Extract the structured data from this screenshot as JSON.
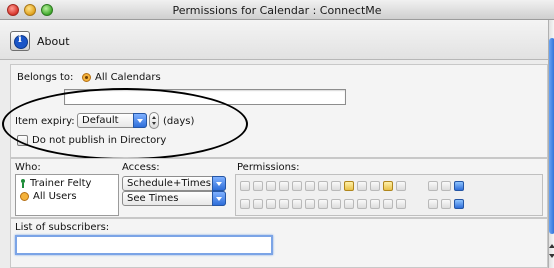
{
  "window": {
    "title": "Permissions for Calendar : ConnectMe"
  },
  "toolbar": {
    "about_label": "About"
  },
  "belongs": {
    "label": "Belongs to:",
    "value": "All Calendars",
    "extra_value": ""
  },
  "expiry": {
    "label": "Item expiry:",
    "select_value": "Default",
    "unit": "(days)"
  },
  "directory": {
    "label": "Do not publish in Directory",
    "checked": false
  },
  "who": {
    "label": "Who:",
    "items": [
      {
        "name": "Trainer Felty",
        "icon": "person-icon"
      },
      {
        "name": "All Users",
        "icon": "group-icon"
      }
    ]
  },
  "access": {
    "label": "Access:",
    "items": [
      "Schedule+Times",
      "See Times"
    ]
  },
  "permissions": {
    "label": "Permissions:"
  },
  "subscribers": {
    "label": "List of subscribers:",
    "value": ""
  },
  "colors": {
    "accent": "#2f6ed9",
    "focus": "#7ba4e6"
  }
}
